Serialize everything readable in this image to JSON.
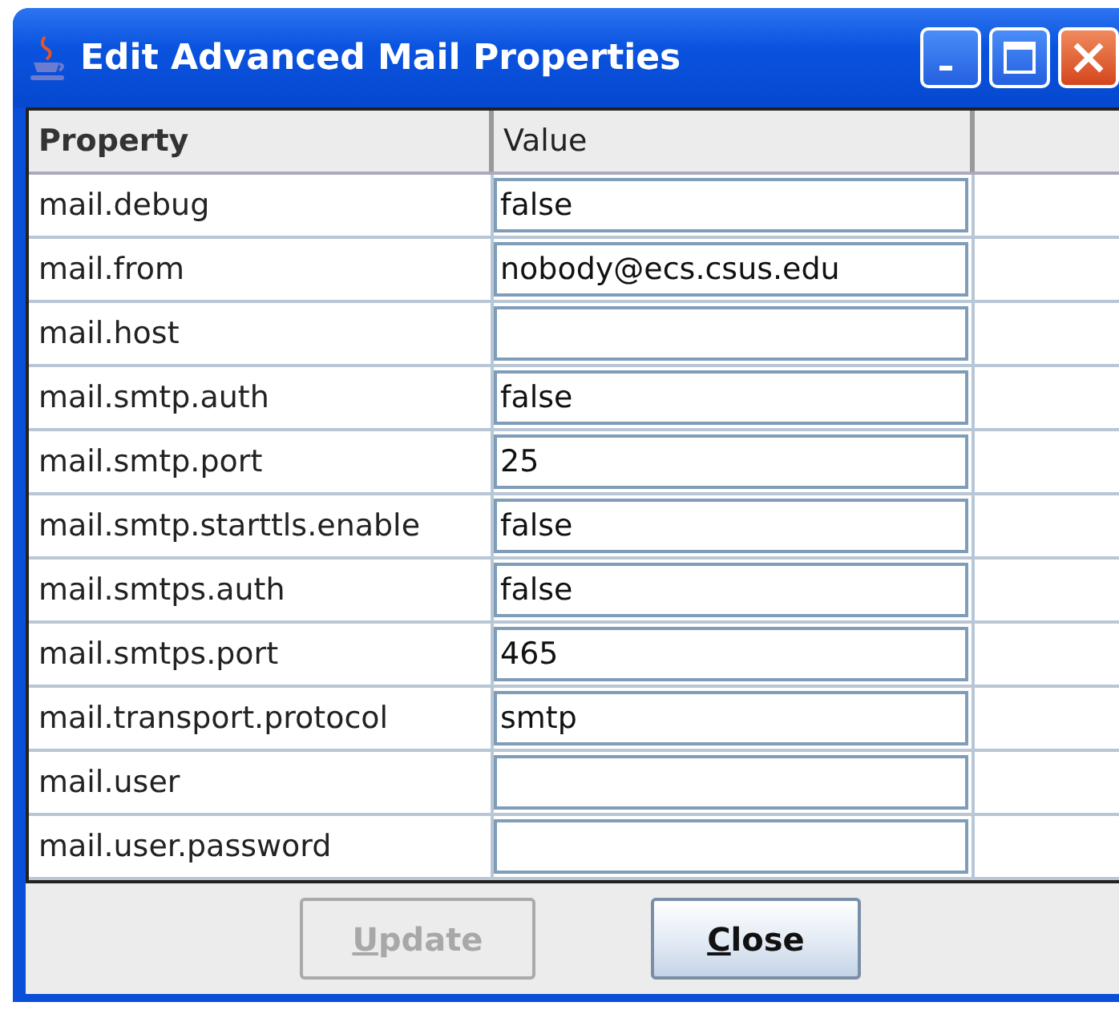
{
  "window": {
    "title": "Edit Advanced Mail Properties"
  },
  "table": {
    "columns": [
      "Property",
      "Value"
    ],
    "rows": [
      {
        "property": "mail.debug",
        "value": "false"
      },
      {
        "property": "mail.from",
        "value": "nobody@ecs.csus.edu"
      },
      {
        "property": "mail.host",
        "value": ""
      },
      {
        "property": "mail.smtp.auth",
        "value": "false"
      },
      {
        "property": "mail.smtp.port",
        "value": "25"
      },
      {
        "property": "mail.smtp.starttls.enable",
        "value": "false"
      },
      {
        "property": "mail.smtps.auth",
        "value": "false"
      },
      {
        "property": "mail.smtps.port",
        "value": "465"
      },
      {
        "property": "mail.transport.protocol",
        "value": "smtp"
      },
      {
        "property": "mail.user",
        "value": ""
      },
      {
        "property": "mail.user.password",
        "value": ""
      }
    ]
  },
  "buttons": [
    {
      "label": "Update",
      "disabled": true
    },
    {
      "label": "Close",
      "disabled": false
    }
  ]
}
